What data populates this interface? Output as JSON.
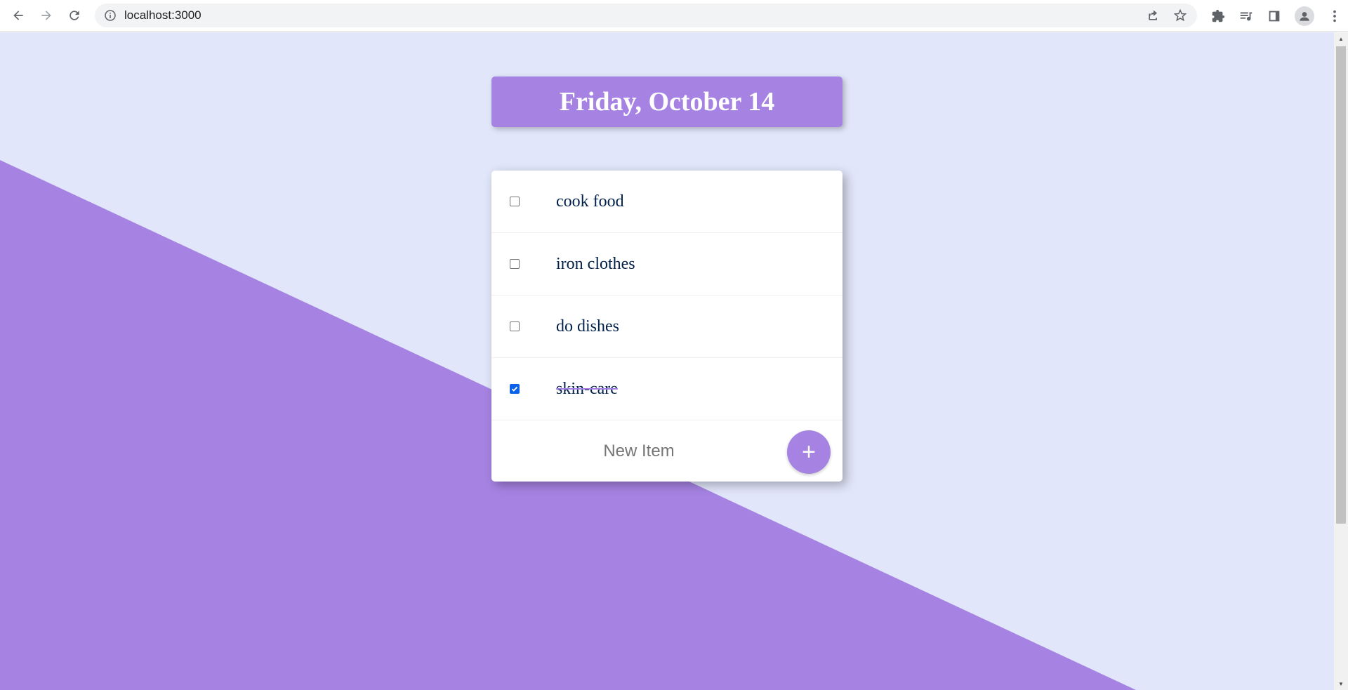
{
  "browser": {
    "url": "localhost:3000"
  },
  "page": {
    "date_heading": "Friday, October 14",
    "items": [
      {
        "label": "cook food",
        "checked": false
      },
      {
        "label": "iron clothes",
        "checked": false
      },
      {
        "label": "do dishes",
        "checked": false
      },
      {
        "label": "skin-care",
        "checked": true
      }
    ],
    "new_item_placeholder": "New Item",
    "add_button_label": "+"
  },
  "colors": {
    "accent": "#a683e3",
    "background": "#e1e6fa",
    "text": "#00204a",
    "checkbox_checked": "#0b62e8"
  }
}
